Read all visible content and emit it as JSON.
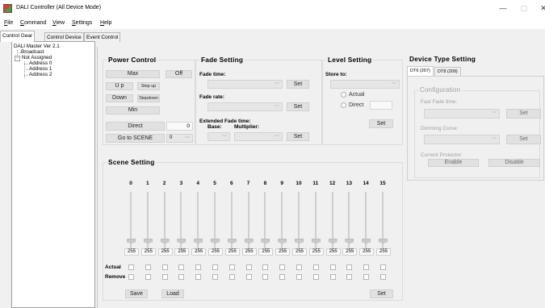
{
  "window": {
    "title": "DALI Controller (All Device Mode)",
    "minimize_glyph": "—",
    "maximize_glyph": "▢",
    "close_glyph": "✕"
  },
  "menu": {
    "items": [
      {
        "underline": "F",
        "rest": "ile"
      },
      {
        "underline": "C",
        "rest": "ommand"
      },
      {
        "underline": "V",
        "rest": "iew"
      },
      {
        "underline": "S",
        "rest": "ettings"
      },
      {
        "underline": "H",
        "rest": "elp"
      }
    ]
  },
  "tabs": [
    "Control Gear",
    "Control Device",
    "Event Control"
  ],
  "tree": {
    "root": "DALI Master Ver 2.1",
    "broadcast": "Broadcast",
    "not_assigned": "Not Assigned",
    "addresses": [
      "Address 0",
      "Address 1",
      "Address 2"
    ],
    "toggle_glyph": "−"
  },
  "power_control": {
    "title": "Power Control",
    "max": "Max",
    "off": "Off",
    "up": "U p",
    "step_up": "Step up",
    "down": "Down",
    "step_down": "Stepdown",
    "min": "Min",
    "direct": "Direct",
    "direct_value": "0",
    "go_to_scene": "Go to SCENE",
    "scene_value": "0"
  },
  "fade_setting": {
    "title": "Fade Setting",
    "fade_time_label": "Fade time:",
    "fade_rate_label": "Fade rate:",
    "extended_label": "Extended Fade time:",
    "base_label": "Base:",
    "multiplier_label": "Multiplier:",
    "set": "Set"
  },
  "level_setting": {
    "title": "Level Setting",
    "store_to_label": "Store to:",
    "actual": "Actual",
    "direct": "Direct",
    "set": "Set"
  },
  "device_type": {
    "title": "Device Type Setting",
    "tabs": [
      "DT6 (207)",
      "DT8 (209)"
    ],
    "configuration": "Configuration",
    "fast_fade_time": "Fast Fade time:",
    "dimming_curve": "Dimming Curve:",
    "current_protector": "Current Protector:",
    "set": "Set",
    "enable": "Enable",
    "disable": "Disable"
  },
  "scene_setting": {
    "title": "Scene Setting",
    "columns": [
      "0",
      "1",
      "2",
      "3",
      "4",
      "5",
      "6",
      "7",
      "8",
      "9",
      "10",
      "11",
      "12",
      "13",
      "14",
      "15"
    ],
    "values": [
      "255",
      "255",
      "255",
      "255",
      "255",
      "255",
      "255",
      "255",
      "255",
      "255",
      "255",
      "255",
      "255",
      "255",
      "255",
      "255"
    ],
    "actual_label": "Actual",
    "remove_label": "Remove",
    "save": "Save",
    "load": "Load",
    "set": "Set"
  }
}
